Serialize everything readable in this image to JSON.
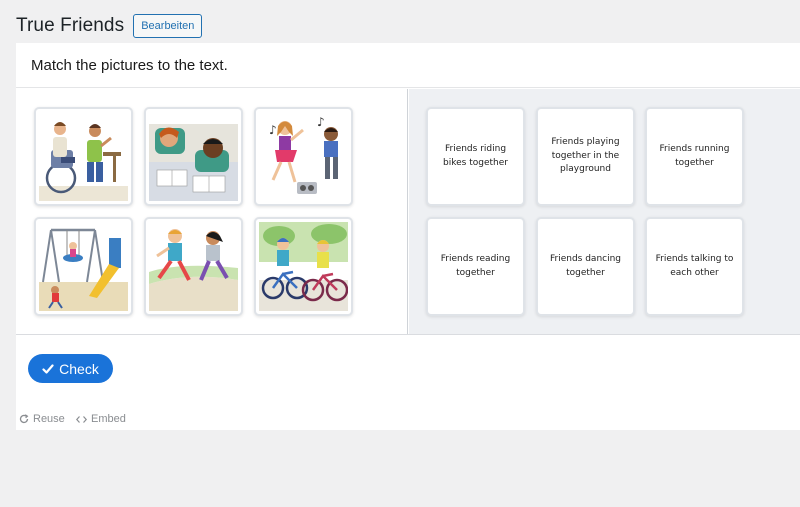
{
  "header": {
    "title": "True Friends",
    "edit_label": "Bearbeiten"
  },
  "task": {
    "instruction": "Match the pictures to the text."
  },
  "pictures": [
    {
      "icon": "friends-wheelchair-talking-picture"
    },
    {
      "icon": "friends-reading-picture"
    },
    {
      "icon": "friends-dancing-picture"
    },
    {
      "icon": "friends-playground-picture"
    },
    {
      "icon": "friends-running-picture"
    },
    {
      "icon": "friends-cycling-picture"
    }
  ],
  "texts": [
    {
      "label": "Friends riding bikes together"
    },
    {
      "label": "Friends playing together in the playground"
    },
    {
      "label": "Friends running together"
    },
    {
      "label": "Friends reading together"
    },
    {
      "label": "Friends dancing together"
    },
    {
      "label": "Friends talking to each other"
    }
  ],
  "actions": {
    "check_label": "Check"
  },
  "footer": {
    "reuse_label": "Reuse",
    "embed_label": "Embed"
  },
  "colors": {
    "accent": "#1a73d9",
    "link": "#2271b1",
    "right_panel": "#eef0f3"
  }
}
